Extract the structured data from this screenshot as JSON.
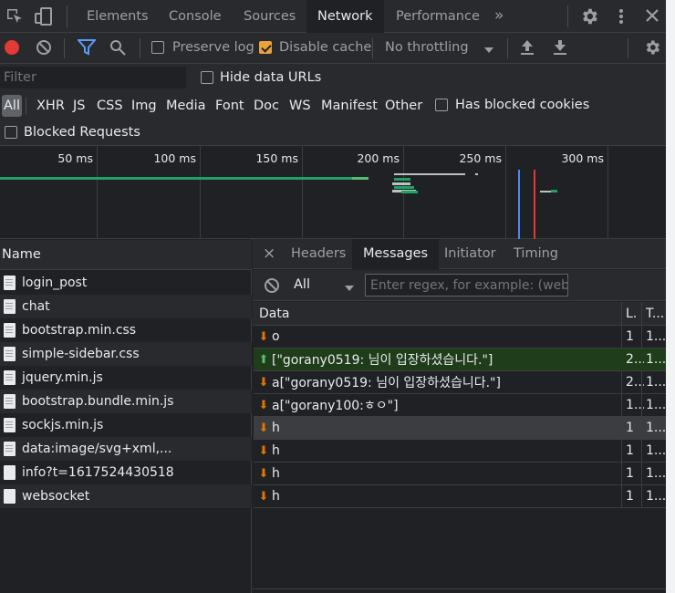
{
  "top_tabs": [
    {
      "label": "Elements"
    },
    {
      "label": "Console"
    },
    {
      "label": "Sources"
    },
    {
      "label": "Network",
      "active": true
    },
    {
      "label": "Performance"
    }
  ],
  "more_tabs": "»",
  "toolbar": {
    "preserve_log": "Preserve log",
    "preserve_log_checked": false,
    "disable_cache": "Disable cache",
    "disable_cache_checked": true,
    "throttling": "No throttling"
  },
  "filter": {
    "placeholder": "Filter",
    "hide_data_urls": "Hide data URLs"
  },
  "types": [
    "All",
    "XHR",
    "JS",
    "CSS",
    "Img",
    "Media",
    "Font",
    "Doc",
    "WS",
    "Manifest",
    "Other"
  ],
  "has_blocked_cookies": "Has blocked cookies",
  "blocked_requests": "Blocked Requests",
  "timeline_ticks": [
    "50 ms",
    "100 ms",
    "150 ms",
    "200 ms",
    "250 ms",
    "300 ms"
  ],
  "names_header": "Name",
  "requests": [
    "login_post",
    "chat",
    "bootstrap.min.css",
    "simple-sidebar.css",
    "jquery.min.js",
    "bootstrap.bundle.min.js",
    "sockjs.min.js",
    "data:image/svg+xml,...",
    "info?t=1617524430518",
    "websocket"
  ],
  "detail_tabs": [
    "Headers",
    "Messages",
    "Initiator",
    "Timing"
  ],
  "close_symbol": "×",
  "message_filter": {
    "select_value": "All",
    "regex_placeholder": "Enter regex, for example: (web)?"
  },
  "message_columns": {
    "data": "Data",
    "length": "L.",
    "time": "T..."
  },
  "messages": [
    {
      "direction": "down",
      "data": "o",
      "length": "1",
      "time": "1..."
    },
    {
      "direction": "up",
      "data": "[\"gorany0519: 님이 입장하셨습니다.\"]",
      "length": "2...",
      "time": "1..."
    },
    {
      "direction": "down",
      "data": "a[\"gorany0519: 님이 입장하셨습니다.\"]",
      "length": "2...",
      "time": "1..."
    },
    {
      "direction": "down",
      "data": "a[\"gorany100:ㅎㅇ\"]",
      "length": "1...",
      "time": "1..."
    },
    {
      "direction": "down",
      "data": "h",
      "length": "1",
      "time": "1..."
    },
    {
      "direction": "down",
      "data": "h",
      "length": "1",
      "time": "1..."
    },
    {
      "direction": "down",
      "data": "h",
      "length": "1",
      "time": "1..."
    },
    {
      "direction": "down",
      "data": "h",
      "length": "1",
      "time": "1..."
    }
  ]
}
